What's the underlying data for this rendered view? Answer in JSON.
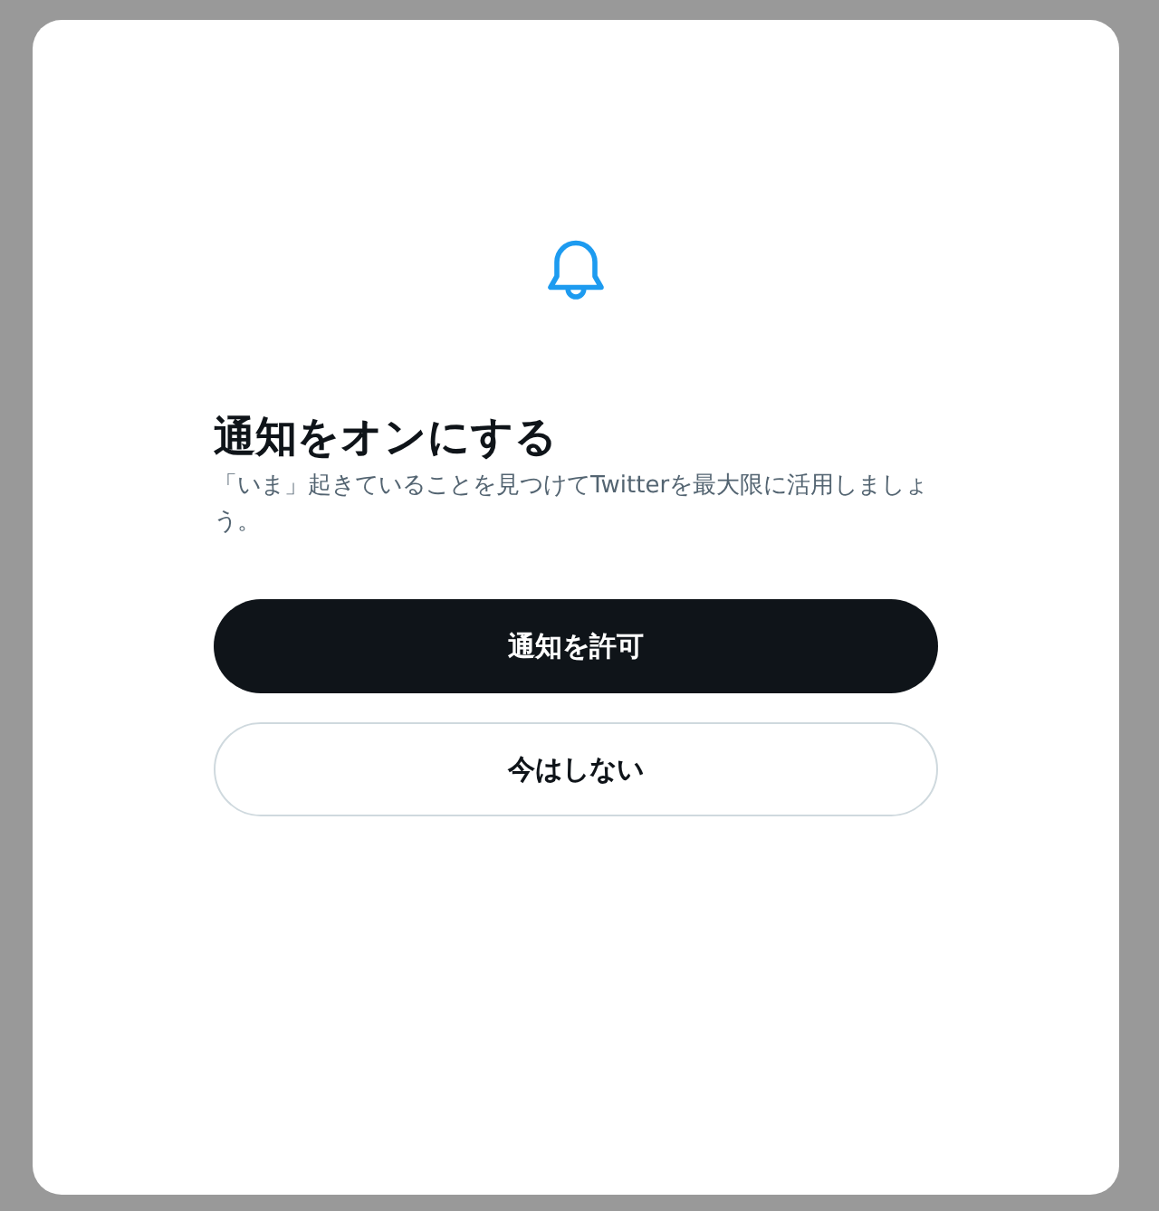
{
  "dialog": {
    "title": "通知をオンにする",
    "description": "「いま」起きていることを見つけてTwitterを最大限に活用しましょう。",
    "buttons": [
      {
        "label": "通知を許可",
        "kind": "primary"
      },
      {
        "label": "今はしない",
        "kind": "secondary"
      }
    ]
  }
}
